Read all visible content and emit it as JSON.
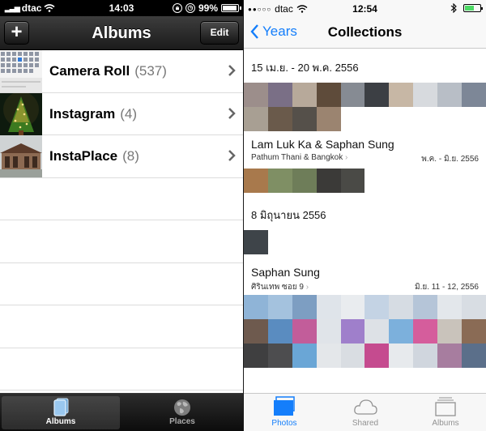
{
  "left": {
    "status": {
      "carrier": "dtac",
      "time": "14:03",
      "battery": "99%"
    },
    "nav": {
      "add_label": "+",
      "title": "Albums",
      "edit_label": "Edit"
    },
    "albums": [
      {
        "name": "Camera Roll",
        "count": "(537)"
      },
      {
        "name": "Instagram",
        "count": "(4)"
      },
      {
        "name": "InstaPlace",
        "count": "(8)"
      }
    ],
    "tabs": [
      {
        "label": "Albums",
        "icon": "albums-icon",
        "selected": true
      },
      {
        "label": "Places",
        "icon": "globe-icon",
        "selected": false
      }
    ]
  },
  "right": {
    "status": {
      "carrier": "dtac",
      "time": "12:54"
    },
    "nav": {
      "back_label": "Years",
      "title": "Collections"
    },
    "sections": [
      {
        "date": "15 เม.ย. - 20 พ.ค. 2556"
      },
      {
        "title": "Lam Luk Ka & Saphan Sung",
        "subtitle": "Pathum Thani & Bangkok",
        "range": "พ.ค. - มิ.ย. 2556"
      },
      {
        "date": "8 มิถุนายน 2556"
      },
      {
        "title": "Saphan Sung",
        "subtitle": "ศิรินเทพ ซอย 9",
        "range": "มิ.ย. 11 - 12, 2556"
      }
    ],
    "tabs": [
      {
        "label": "Photos",
        "icon": "photos-icon",
        "selected": true
      },
      {
        "label": "Shared",
        "icon": "cloud-icon",
        "selected": false
      },
      {
        "label": "Albums",
        "icon": "albums-icon",
        "selected": false
      }
    ]
  },
  "colors": {
    "ios7_accent": "#147efb",
    "ios6_bar": "#1b1b1b"
  }
}
